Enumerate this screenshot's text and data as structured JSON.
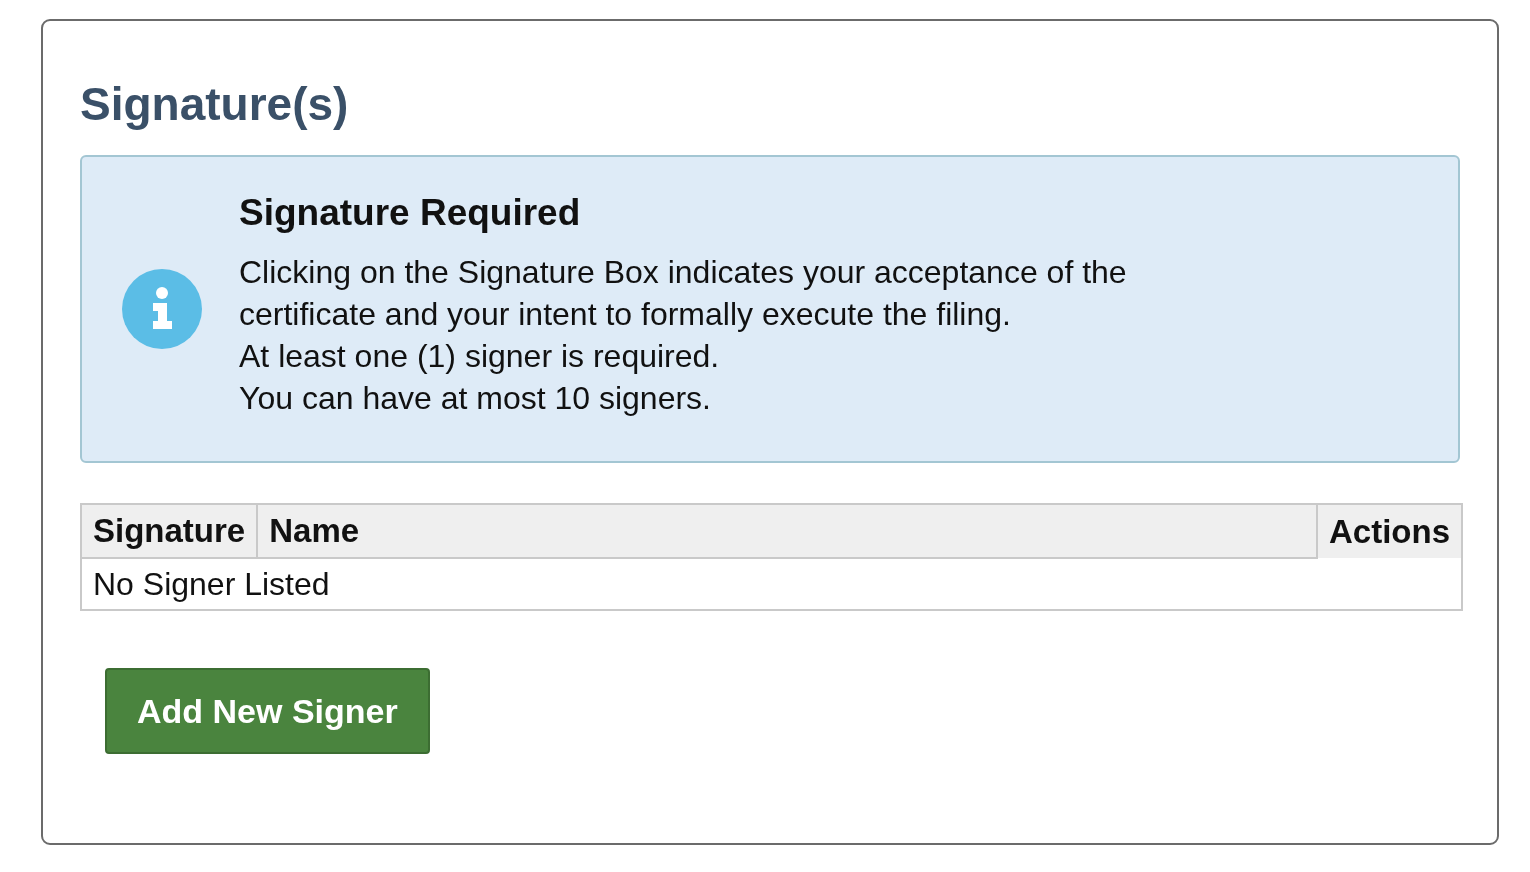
{
  "title": "Signature(s)",
  "notice": {
    "kind": "info",
    "heading": "Signature Required",
    "lines": [
      "Clicking on the Signature Box indicates your acceptance of the certificate and your intent to formally execute the filing.",
      "At least one (1) signer is required.",
      "You can have at most 10 signers."
    ]
  },
  "table": {
    "columns": [
      "Signature",
      "Name",
      "Actions"
    ],
    "empty_message": "No Signer Listed"
  },
  "buttons": [
    {
      "label": "Add New Signer"
    }
  ]
}
